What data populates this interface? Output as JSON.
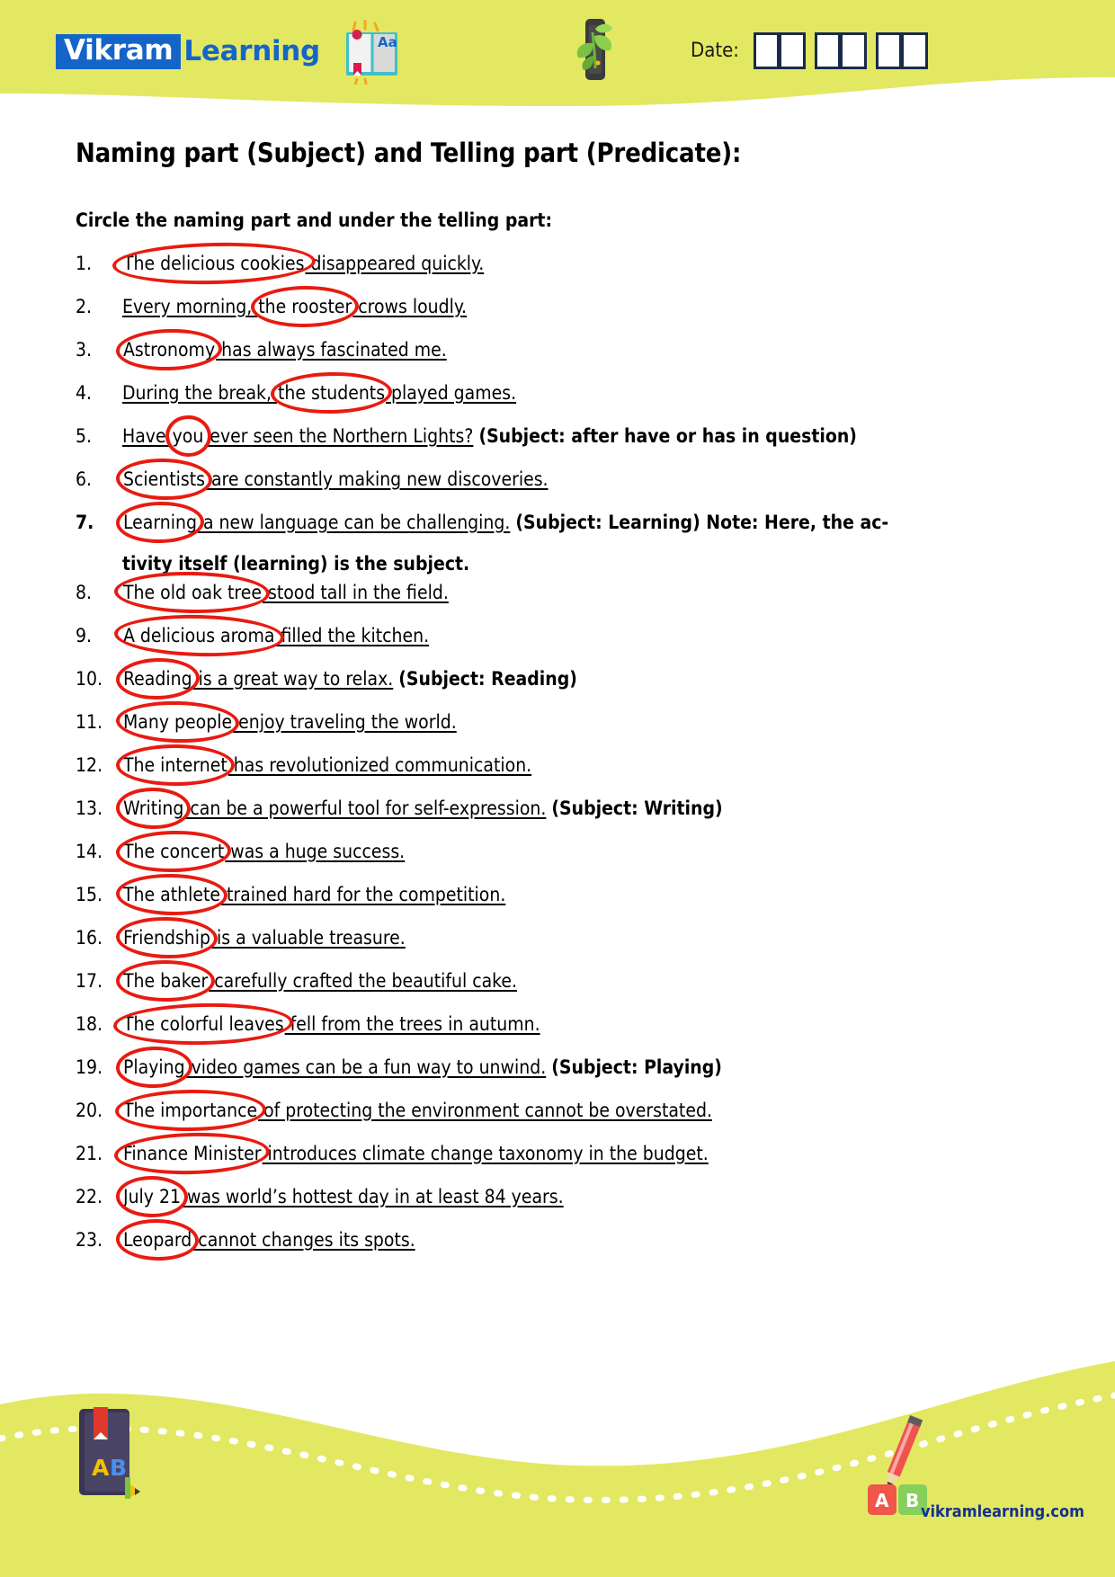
{
  "header": {
    "logo_badge": "Vikram",
    "logo_word": "Learning",
    "date_label": "Date:",
    "date_boxes": 6,
    "icons": [
      "open-book-icon",
      "plant-growth-icon"
    ],
    "bg_color": "#e3e862"
  },
  "document": {
    "title": "Naming part (Subject) and Telling part (Predicate):",
    "instruction": "Circle the naming part and under the telling part:"
  },
  "items": [
    {
      "num": "1.",
      "subject": "The delicious cookies",
      "predicate": " disappeared quickly.",
      "annotation": ""
    },
    {
      "num": "2.",
      "lead": "Every morning, ",
      "subject": "the rooster",
      "predicate": " crows loudly.",
      "annotation": ""
    },
    {
      "num": "3.",
      "subject": "Astronomy",
      "predicate": " has always fascinated me.",
      "annotation": ""
    },
    {
      "num": "4.",
      "lead": "During the break, ",
      "subject": "the students",
      "predicate": " played games.",
      "annotation": ""
    },
    {
      "num": "5.",
      "lead": "Have ",
      "subject": "you",
      "predicate": " ever seen the Northern Lights?",
      "annotation": "(Subject: after have or has in question)"
    },
    {
      "num": "6.",
      "subject": "Scientists",
      "predicate": " are constantly making new discoveries.",
      "annotation": ""
    },
    {
      "num": "7.",
      "bold_num": true,
      "subject": "Learning",
      "predicate": " a new language can be challenging.",
      "annotation": "(Subject: Learning) Note: Here, the ac-",
      "continuation": "tivity itself (learning) is the subject."
    },
    {
      "num": "8.",
      "subject": "The old oak tree",
      "predicate": " stood tall in the field.",
      "annotation": ""
    },
    {
      "num": "9.",
      "subject": "A delicious aroma",
      "predicate": " filled the kitchen.",
      "annotation": ""
    },
    {
      "num": "10.",
      "subject": "Reading",
      "predicate": " is a great way to relax.",
      "annotation": "(Subject: Reading)"
    },
    {
      "num": "11.",
      "subject": "Many people",
      "predicate": " enjoy traveling the world.",
      "annotation": ""
    },
    {
      "num": "12.",
      "subject": "The internet",
      "predicate": " has revolutionized communication.",
      "annotation": ""
    },
    {
      "num": "13.",
      "subject": "Writing",
      "predicate": " can be a powerful tool for self-expression.",
      "annotation": "(Subject: Writing)"
    },
    {
      "num": "14.",
      "subject": "The concert",
      "predicate": " was a huge success.",
      "annotation": ""
    },
    {
      "num": "15.",
      "subject": "The athlete",
      "predicate": " trained hard for the competition.",
      "annotation": ""
    },
    {
      "num": "16.",
      "subject": "Friendship",
      "predicate": " is a valuable treasure.",
      "annotation": ""
    },
    {
      "num": "17.",
      "subject": "The baker",
      "predicate": " carefully crafted the beautiful cake.",
      "annotation": ""
    },
    {
      "num": "18.",
      "subject": "The colorful leaves",
      "predicate": " fell from the trees in autumn.",
      "annotation": ""
    },
    {
      "num": "19.",
      "subject": "Playing",
      "predicate": " video games can be a fun way to unwind.",
      "annotation": "(Subject: Playing)"
    },
    {
      "num": "20.",
      "subject": "The importance",
      "predicate": " of protecting the environment cannot be overstated.",
      "annotation": ""
    },
    {
      "num": "21.",
      "subject": "Finance Minister",
      "predicate": " introduces climate change taxonomy in the budget.",
      "annotation": ""
    },
    {
      "num": "22.",
      "subject": "July 21",
      "predicate": " was world’s hottest day in at least 84 years.",
      "annotation": ""
    },
    {
      "num": "23.",
      "subject": "Leopard",
      "predicate": " cannot changes its spots.",
      "annotation": ""
    }
  ],
  "footer": {
    "website": "vikramlearning.com",
    "icons": [
      "book-ab-icon",
      "pencil-ab-blocks-icon"
    ],
    "bg_color": "#e3e862"
  },
  "colors": {
    "accent_yellow": "#e3e862",
    "brand_blue": "#1565c9",
    "circle_red": "#e81b10",
    "footer_link": "#15308f"
  }
}
